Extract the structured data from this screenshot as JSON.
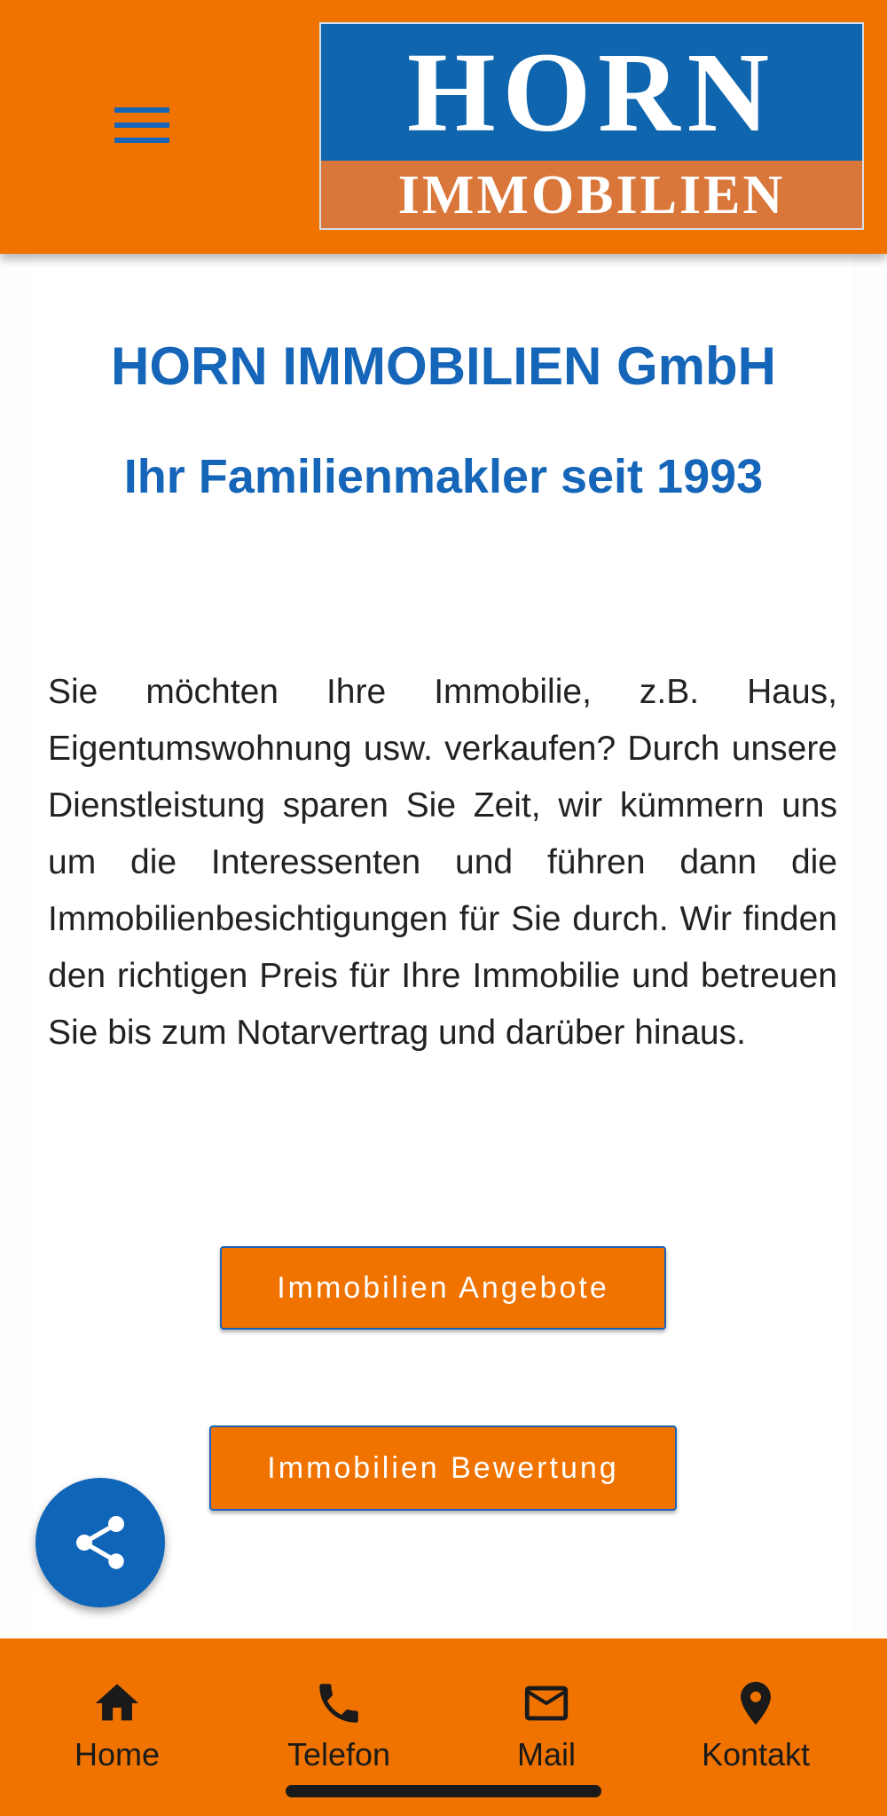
{
  "header": {
    "logo_top": "HORN",
    "logo_bottom": "IMMOBILIEN"
  },
  "main": {
    "title": "HORN IMMOBILIEN GmbH",
    "subtitle": "Ihr Familienmakler seit 1993",
    "description": "Sie möchten Ihre Immobilie, z.B. Haus, Eigentumswohnung usw. verkaufen? Durch unsere Dienstleistung sparen Sie Zeit, wir kümmern uns um die Interessenten und führen dann die Immobilienbesichtigungen für Sie durch. Wir finden den richtigen Preis für Ihre Immobilie und betreuen Sie bis zum Notarvertrag und darüber hinaus.",
    "button_offers": "Immobilien Angebote",
    "button_valuation": "Immobilien Bewertung"
  },
  "fab": {
    "icon": "share-icon"
  },
  "bottom_nav": {
    "items": [
      {
        "label": "Home",
        "icon": "home-icon"
      },
      {
        "label": "Telefon",
        "icon": "phone-icon"
      },
      {
        "label": "Mail",
        "icon": "mail-icon"
      },
      {
        "label": "Kontakt",
        "icon": "location-pin-icon"
      }
    ]
  },
  "colors": {
    "brand_orange": "#f07300",
    "brand_blue": "#1565b8",
    "logo_blue": "#0f65ae",
    "logo_orange": "#d9763a"
  }
}
